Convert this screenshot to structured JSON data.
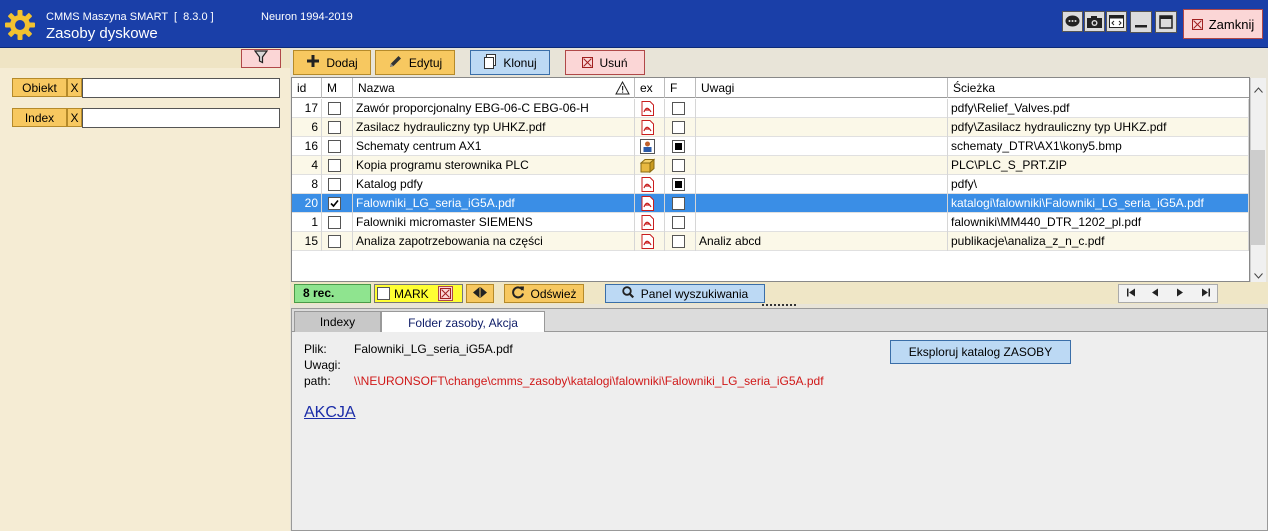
{
  "window": {
    "app_title": "CMMS Maszyna SMART  [  8.3.0 ]",
    "copyright": "Neuron 1994-2019",
    "title": "Zasoby dyskowe",
    "close_label": "Zamknij"
  },
  "left_panel": {
    "filters": [
      {
        "label": "Obiekt",
        "clear": "X",
        "value": ""
      },
      {
        "label": "Index",
        "clear": "X",
        "value": ""
      }
    ]
  },
  "toolbar": {
    "add_label": "Dodaj",
    "edit_label": "Edytuj",
    "clone_label": "Klonuj",
    "delete_label": "Usuń"
  },
  "table": {
    "columns": [
      "id",
      "M",
      "Nazwa",
      "ex",
      "F",
      "Uwagi",
      "Ścieżka"
    ],
    "selected_index": 5,
    "rows": [
      {
        "id": "17",
        "m": false,
        "nazwa": "Zawór proporcjonalny EBG-06-C EBG-06-H",
        "ex": "pdf-icon",
        "f": false,
        "uwagi": "",
        "sciezka": "pdfy\\Relief_Valves.pdf"
      },
      {
        "id": "6",
        "m": false,
        "nazwa": "Zasilacz hydrauliczny typ UHKZ.pdf",
        "ex": "pdf-icon",
        "f": false,
        "uwagi": "",
        "sciezka": "pdfy\\Zasilacz hydrauliczny typ UHKZ.pdf"
      },
      {
        "id": "16",
        "m": false,
        "nazwa": "Schematy centrum AX1",
        "ex": "image-icon",
        "f": true,
        "uwagi": "",
        "sciezka": "schematy_DTR\\AX1\\kony5.bmp"
      },
      {
        "id": "4",
        "m": false,
        "nazwa": "Kopia programu sterownika PLC",
        "ex": "archive-icon",
        "f": false,
        "uwagi": "",
        "sciezka": "PLC\\PLC_S_PRT.ZIP"
      },
      {
        "id": "8",
        "m": false,
        "nazwa": "Katalog pdfy",
        "ex": "pdf-icon",
        "f": true,
        "uwagi": "",
        "sciezka": "pdfy\\"
      },
      {
        "id": "20",
        "m": true,
        "nazwa": "Falowniki_LG_seria_iG5A.pdf",
        "ex": "pdf-icon",
        "f": false,
        "uwagi": "",
        "sciezka": "katalogi\\falowniki\\Falowniki_LG_seria_iG5A.pdf"
      },
      {
        "id": "1",
        "m": false,
        "nazwa": "Falowniki micromaster SIEMENS",
        "ex": "pdf-icon",
        "f": false,
        "uwagi": "",
        "sciezka": "falowniki\\MM440_DTR_1202_pl.pdf"
      },
      {
        "id": "15",
        "m": false,
        "nazwa": "Analiza zapotrzebowania na części",
        "ex": "pdf-icon",
        "f": false,
        "uwagi": "Analiz abcd",
        "sciezka": "publikacje\\analiza_z_n_c.pdf"
      }
    ]
  },
  "status_bar": {
    "rec_count": "8 rec.",
    "mark_label": "MARK",
    "refresh_label": "Odśwież",
    "search_panel_label": "Panel wyszukiwania"
  },
  "tabs": [
    {
      "label": "Indexy",
      "active": false
    },
    {
      "label": "Folder zasoby, Akcja",
      "active": true
    }
  ],
  "detail": {
    "plik_label": "Plik:",
    "plik_value": "Falowniki_LG_seria_iG5A.pdf",
    "uwagi_label": "Uwagi:",
    "uwagi_value": "",
    "path_label": "path:",
    "path_value": "\\\\NEURONSOFT\\change\\cmms_zasoby\\katalogi\\falowniki\\Falowniki_LG_seria_iG5A.pdf",
    "explore_label": "Eksploruj katalog ZASOBY",
    "akcja_label": "AKCJA"
  },
  "colors": {
    "titlebar": "#1a3fa8",
    "selection": "#3a8ee6",
    "path_red": "#d01818"
  }
}
